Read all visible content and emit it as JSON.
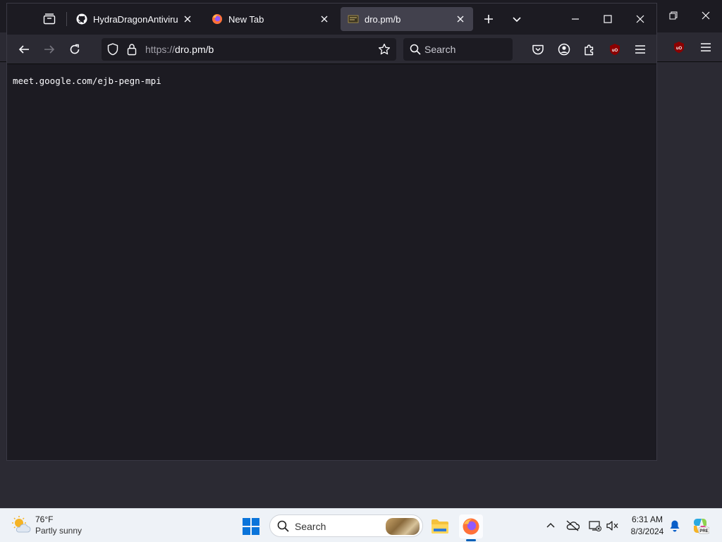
{
  "browser": {
    "tabs": [
      {
        "title": "HydraDragonAntivirus/hy",
        "icon": "github-icon"
      },
      {
        "title": "New Tab",
        "icon": "firefox-icon"
      },
      {
        "title": "dro.pm/b",
        "icon": "site-favicon",
        "active": true
      }
    ],
    "url": {
      "scheme": "https://",
      "host": "dro.pm/b"
    },
    "search_placeholder": "Search",
    "page_text": "meet.google.com/ejb-pegn-mpi",
    "ublock_label": "uO"
  },
  "taskbar": {
    "weather": {
      "temp": "76°F",
      "condition": "Partly sunny"
    },
    "search_placeholder": "Search",
    "clock": {
      "time": "6:31 AM",
      "date": "8/3/2024"
    },
    "copilot_badge": "PRE"
  },
  "colors": {
    "accent": "#005fb8",
    "ublock_red": "#8b0000",
    "firefox_orange": "#ff7139"
  }
}
